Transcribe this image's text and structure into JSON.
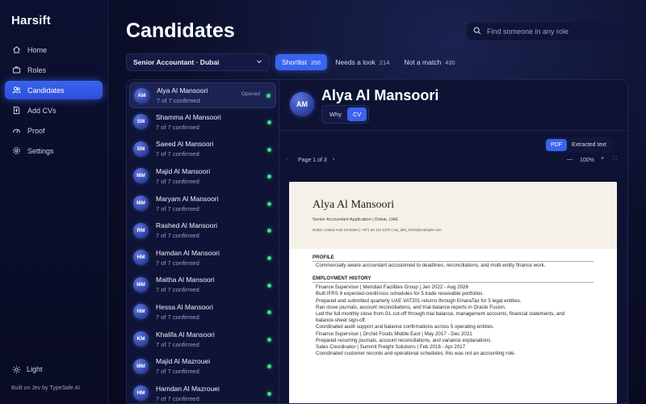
{
  "app": {
    "brand": "Harsift",
    "footer": "Built on Jev by TypeSafe AI",
    "theme_label": "Light"
  },
  "nav": [
    {
      "label": "Home",
      "icon": "home-icon"
    },
    {
      "label": "Roles",
      "icon": "briefcase-icon"
    },
    {
      "label": "Candidates",
      "icon": "users-icon",
      "active": true
    },
    {
      "label": "Add CVs",
      "icon": "upload-icon"
    },
    {
      "label": "Proof",
      "icon": "gauge-icon"
    },
    {
      "label": "Settings",
      "icon": "gear-icon"
    }
  ],
  "page": {
    "title": "Candidates"
  },
  "search": {
    "placeholder": "Find someone in any role"
  },
  "role_select": {
    "value": "Senior Accountant · Dubai"
  },
  "tabs": [
    {
      "label": "Shortlist",
      "count": "356",
      "active": true
    },
    {
      "label": "Needs a look",
      "count": "214"
    },
    {
      "label": "Not a match",
      "count": "430"
    }
  ],
  "candidates": [
    {
      "initials": "AM",
      "name": "Alya Al Mansoori",
      "sub": "7 of 7 confirmed",
      "status": "Opened",
      "selected": true
    },
    {
      "initials": "SM",
      "name": "Shamma Al Mansoori",
      "sub": "7 of 7 confirmed"
    },
    {
      "initials": "SM",
      "name": "Saeed Al Mansoori",
      "sub": "7 of 7 confirmed"
    },
    {
      "initials": "MM",
      "name": "Majid Al Mansoori",
      "sub": "7 of 7 confirmed"
    },
    {
      "initials": "MM",
      "name": "Maryam Al Mansoori",
      "sub": "7 of 7 confirmed"
    },
    {
      "initials": "RM",
      "name": "Rashed Al Mansoori",
      "sub": "7 of 7 confirmed"
    },
    {
      "initials": "HM",
      "name": "Hamdan Al Mansoori",
      "sub": "7 of 7 confirmed"
    },
    {
      "initials": "MM",
      "name": "Maitha Al Mansoori",
      "sub": "7 of 7 confirmed"
    },
    {
      "initials": "HM",
      "name": "Hessa Al Mansoori",
      "sub": "7 of 7 confirmed"
    },
    {
      "initials": "KM",
      "name": "Khalifa Al Mansoori",
      "sub": "7 of 7 confirmed"
    },
    {
      "initials": "MM",
      "name": "Majid Al Mazrouei",
      "sub": "7 of 7 confirmed"
    },
    {
      "initials": "HM",
      "name": "Hamdan Al Mazrouei",
      "sub": "7 of 7 confirmed"
    }
  ],
  "detail": {
    "initials": "AM",
    "name": "Alya Al Mansoori",
    "seg": {
      "why": "Why",
      "cv": "CV"
    },
    "view": {
      "pdf": "PDF",
      "text": "Extracted text"
    },
    "pager": {
      "page": "Page 1 of 3",
      "zoom": "100%"
    }
  },
  "cv": {
    "name": "Alya Al Mansoori",
    "role": "Senior Accountant Application | Dubai, UAE",
    "contact": "Dubai, United Arab Emirates | +971 50 110 1370 | sai_deb_0010@example.com",
    "profile_heading": "PROFILE",
    "profile": "Commercially aware accountant accustomed to deadlines, reconciliations, and multi-entity finance work.",
    "employment_heading": "EMPLOYMENT HISTORY",
    "employment": [
      "Finance Supervisor | Meridian Facilities Group | Jan 2022 - Aug 2026",
      "Built IFRS 9 expected-credit-loss schedules for 5 trade receivable portfolios.",
      "Prepared and submitted quarterly UAE VAT201 returns through EmaraTax for 5 legal entities.",
      "Ran close journals, account reconciliations, and trial-balance reports in Oracle Fusion.",
      "Led the full monthly close from GL cut-off through trial balance, management accounts, financial statements, and",
      "balance-sheet sign-off.",
      "Coordinated audit support and balance confirmations across 5 operating entities.",
      "Finance Supervisor | Orchid Foods Middle East | May 2017 - Dec 2021",
      "Prepared recurring journals, account reconciliations, and variance explanations.",
      "Sales Coordinator | Summit Freight Solutions | Feb 2016 - Apr 2017",
      "Coordinated customer records and operational schedules; this was not an accounting role."
    ]
  }
}
